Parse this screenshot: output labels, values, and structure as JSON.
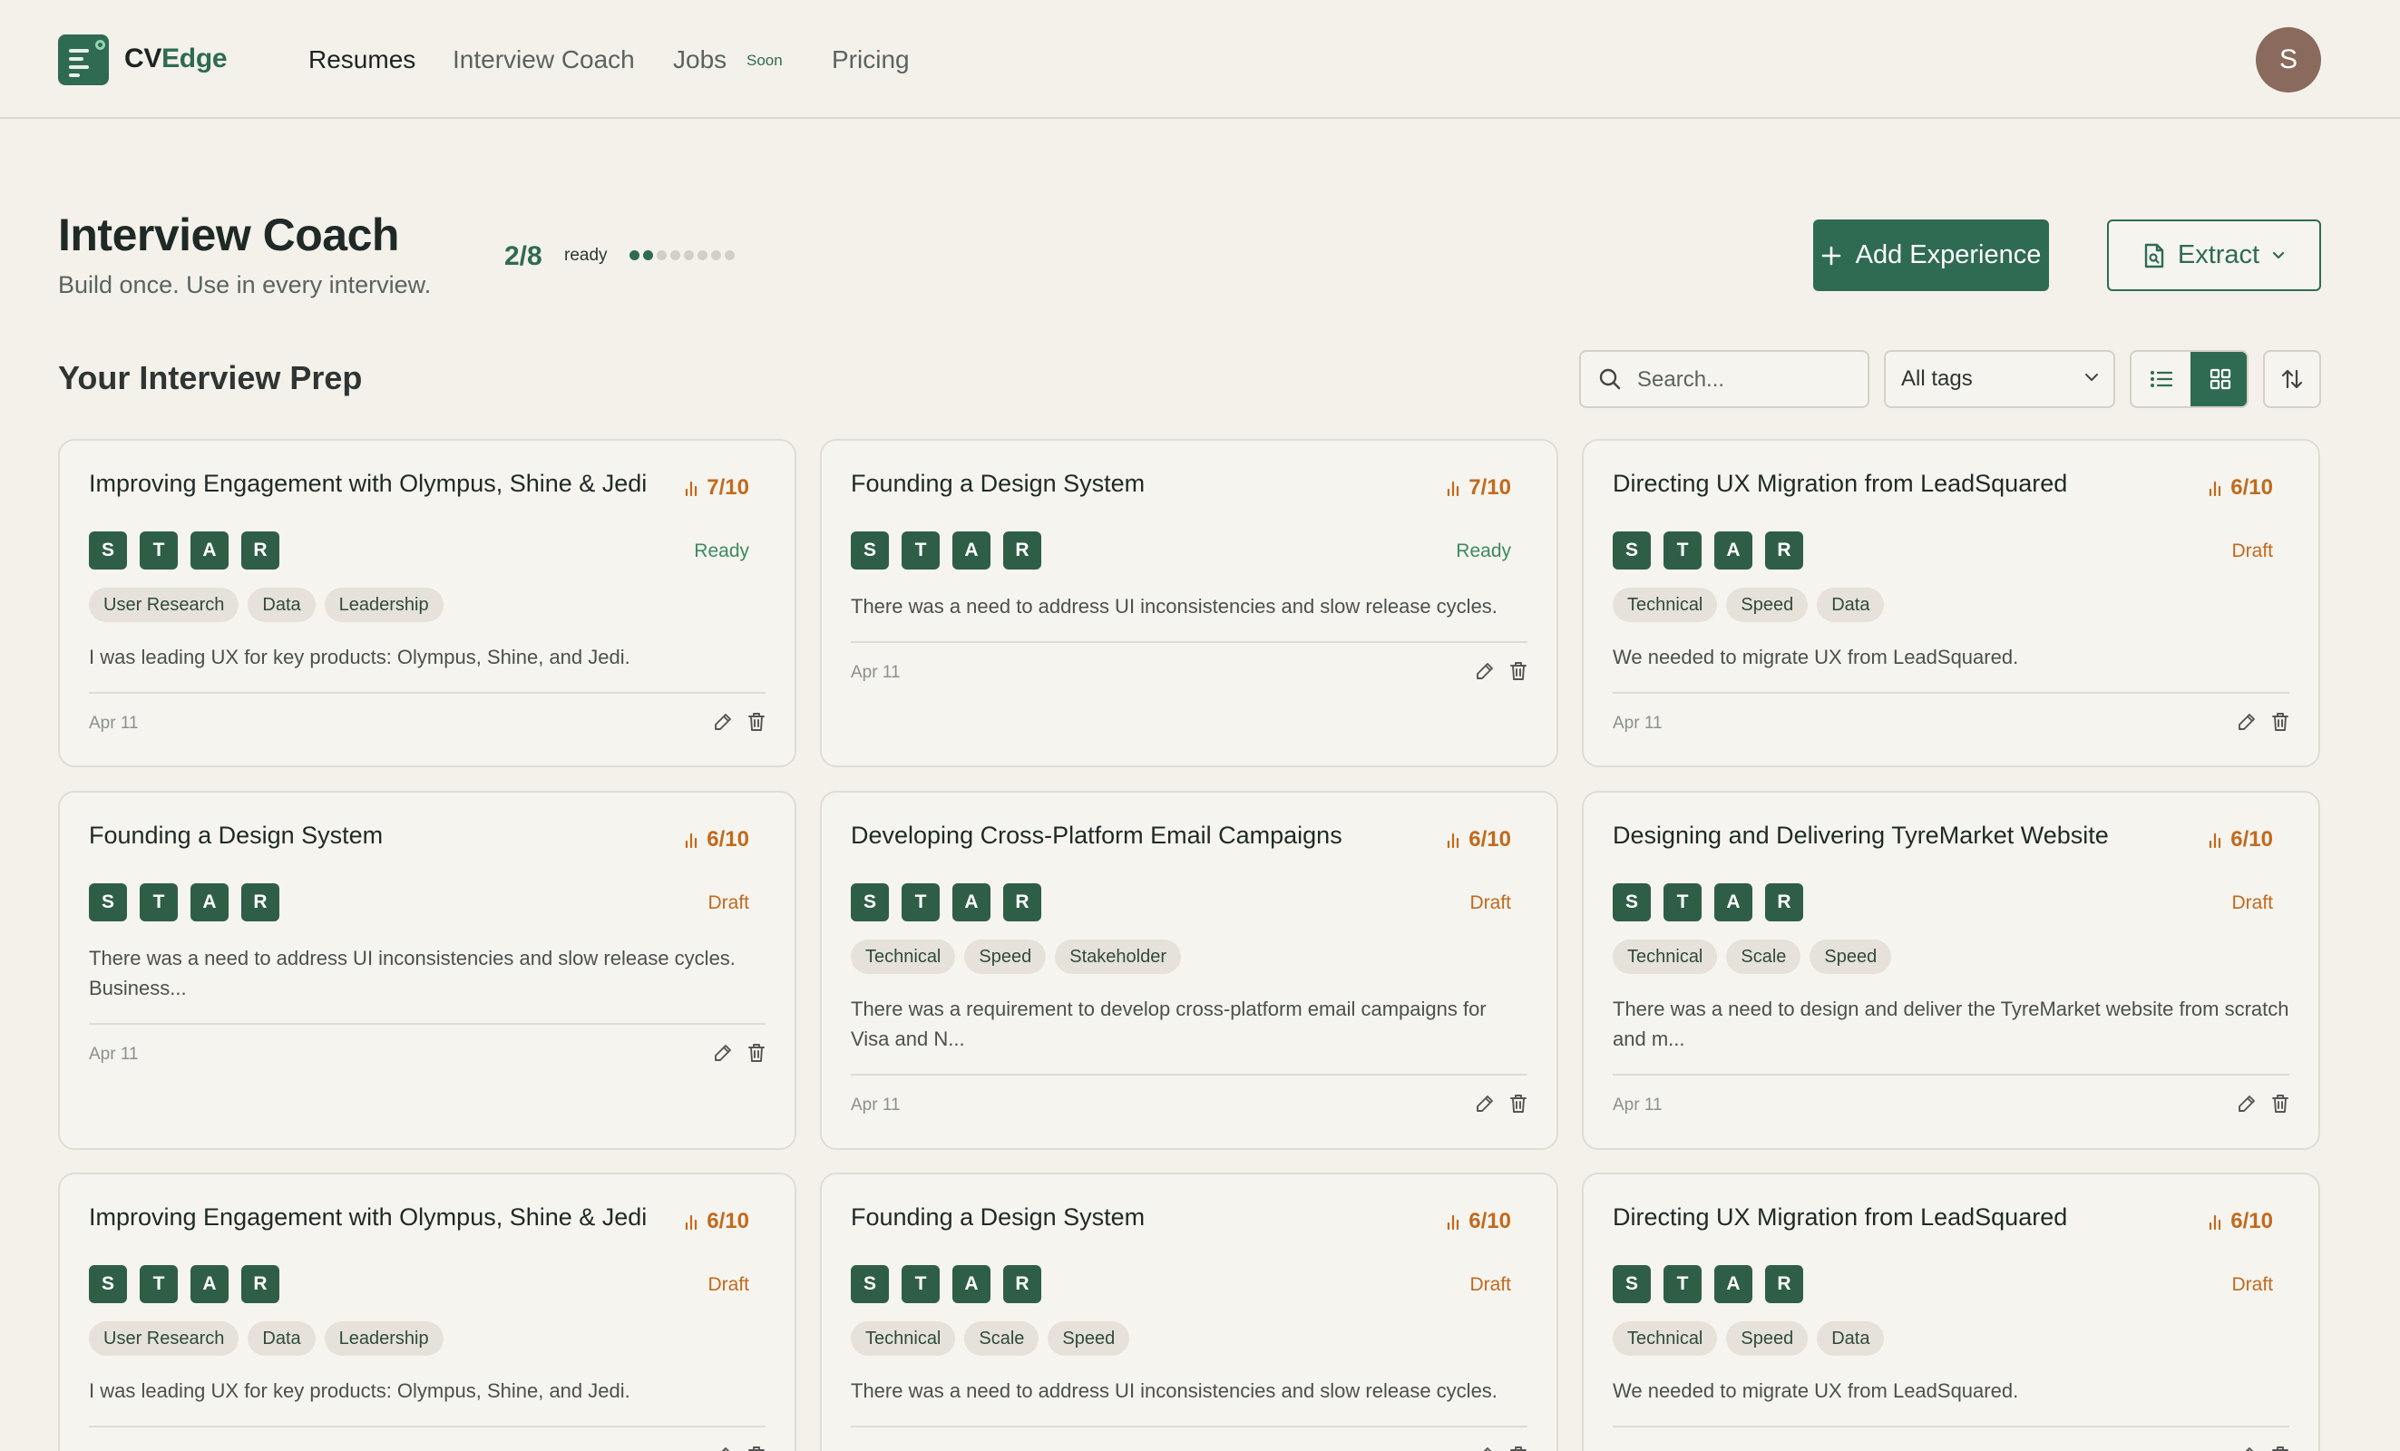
{
  "nav": {
    "brand_prefix": "CV",
    "brand_suffix": "Edge",
    "links": [
      "Resumes",
      "Interview Coach",
      "Jobs",
      "Pricing"
    ],
    "jobs_badge": "Soon",
    "avatar_initial": "S"
  },
  "header": {
    "title": "Interview Coach",
    "subtitle": "Build once. Use in every interview.",
    "ready_count": "2/8",
    "ready_label": "ready",
    "progress": {
      "ready": 2,
      "total": 8
    },
    "add_button": "Add Experience",
    "extract_button": "Extract"
  },
  "toolbar": {
    "section_title": "Your Interview Prep",
    "search_placeholder": "Search...",
    "tag_filter": "All tags",
    "active_view": "grid"
  },
  "colors": {
    "accent": "#2f6b52",
    "draft": "#c26a1d",
    "ready": "#3b8a5f",
    "background": "#f4f1eb"
  },
  "cards": [
    {
      "title": "Improving Engagement with Olympus, Shine & Jedi",
      "score": "7/10",
      "status": "Ready",
      "star": [
        "S",
        "T",
        "A",
        "R"
      ],
      "tags": [
        "User Research",
        "Data",
        "Leadership"
      ],
      "desc": "I was leading UX for key products: Olympus, Shine, and Jedi.",
      "date": "Apr 11"
    },
    {
      "title": "Founding a Design System",
      "score": "7/10",
      "status": "Ready",
      "star": [
        "S",
        "T",
        "A",
        "R"
      ],
      "tags": [],
      "desc": "There was a need to address UI inconsistencies and slow release cycles.",
      "date": "Apr 11"
    },
    {
      "title": "Directing UX Migration from LeadSquared",
      "score": "6/10",
      "status": "Draft",
      "star": [
        "S",
        "T",
        "A",
        "R"
      ],
      "tags": [
        "Technical",
        "Speed",
        "Data"
      ],
      "desc": "We needed to migrate UX from LeadSquared.",
      "date": "Apr 11"
    },
    {
      "title": "Founding a Design System",
      "score": "6/10",
      "status": "Draft",
      "star": [
        "S",
        "T",
        "A",
        "R"
      ],
      "tags": [],
      "desc": "There was a need to address UI inconsistencies and slow release cycles. Business...",
      "date": "Apr 11"
    },
    {
      "title": "Developing Cross-Platform Email Campaigns",
      "score": "6/10",
      "status": "Draft",
      "star": [
        "S",
        "T",
        "A",
        "R"
      ],
      "tags": [
        "Technical",
        "Speed",
        "Stakeholder"
      ],
      "desc": "There was a requirement to develop cross-platform email campaigns for Visa and N...",
      "date": "Apr 11"
    },
    {
      "title": "Designing and Delivering TyreMarket Website",
      "score": "6/10",
      "status": "Draft",
      "star": [
        "S",
        "T",
        "A",
        "R"
      ],
      "tags": [
        "Technical",
        "Scale",
        "Speed"
      ],
      "desc": "There was a need to design and deliver the TyreMarket website from scratch and m...",
      "date": "Apr 11"
    },
    {
      "title": "Improving Engagement with Olympus, Shine & Jedi",
      "score": "6/10",
      "status": "Draft",
      "star": [
        "S",
        "T",
        "A",
        "R"
      ],
      "tags": [
        "User Research",
        "Data",
        "Leadership"
      ],
      "desc": "I was leading UX for key products: Olympus, Shine, and Jedi.",
      "date": ""
    },
    {
      "title": "Founding a Design System",
      "score": "6/10",
      "status": "Draft",
      "star": [
        "S",
        "T",
        "A",
        "R"
      ],
      "tags": [
        "Technical",
        "Scale",
        "Speed"
      ],
      "desc": "There was a need to address UI inconsistencies and slow release cycles.",
      "date": ""
    },
    {
      "title": "Directing UX Migration from LeadSquared",
      "score": "6/10",
      "status": "Draft",
      "star": [
        "S",
        "T",
        "A",
        "R"
      ],
      "tags": [
        "Technical",
        "Speed",
        "Data"
      ],
      "desc": "We needed to migrate UX from LeadSquared.",
      "date": ""
    }
  ]
}
